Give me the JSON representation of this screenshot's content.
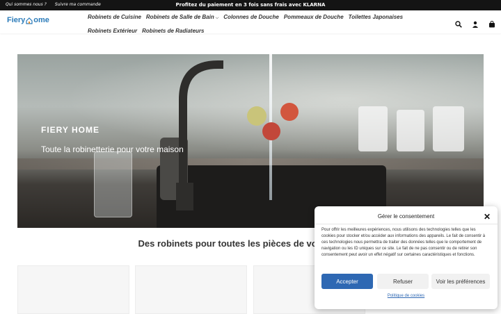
{
  "topbar": {
    "links": [
      "Qui sommes nous ?",
      "Suivre ma commande"
    ],
    "promo": "Profitez du paiement en 3 fois sans frais avec KLARNA"
  },
  "header": {
    "logo_left": "Fiery",
    "logo_right": "ome",
    "nav": [
      {
        "label": "Robinets de Cuisine"
      },
      {
        "label": "Robinets de Salle de Bain"
      },
      {
        "label": "Colonnes de Douche"
      },
      {
        "label": "Pommeaux de Douche"
      },
      {
        "label": "Toilettes Japonaises"
      },
      {
        "label": "Robinets Extérieur"
      },
      {
        "label": "Robinets de Radiateurs"
      }
    ],
    "icons": [
      "search-icon",
      "user-icon",
      "cart-icon"
    ]
  },
  "hero": {
    "eyebrow": "FIERY HOME",
    "title": "Toute la robinetterie pour votre maison"
  },
  "section": {
    "title": "Des robinets pour toutes les pièces de votre maison"
  },
  "cookie": {
    "title": "Gérer le consentement",
    "text": "Pour offrir les meilleures expériences, nous utilisons des technologies telles que les cookies pour stocker et/ou accéder aux informations des appareils. Le fait de consentir à ces technologies nous permettra de traiter des données telles que le comportement de navigation ou les ID uniques sur ce site. Le fait de ne pas consentir ou de retirer son consentement peut avoir un effet négatif sur certaines caractéristiques et fonctions.",
    "accept": "Accepter",
    "refuse": "Refuser",
    "prefs": "Voir les préférences",
    "policy": "Politique de cookies"
  },
  "colors": {
    "accent": "#2e68b3",
    "topbar": "#141414",
    "logo": "#2b7bb9"
  }
}
